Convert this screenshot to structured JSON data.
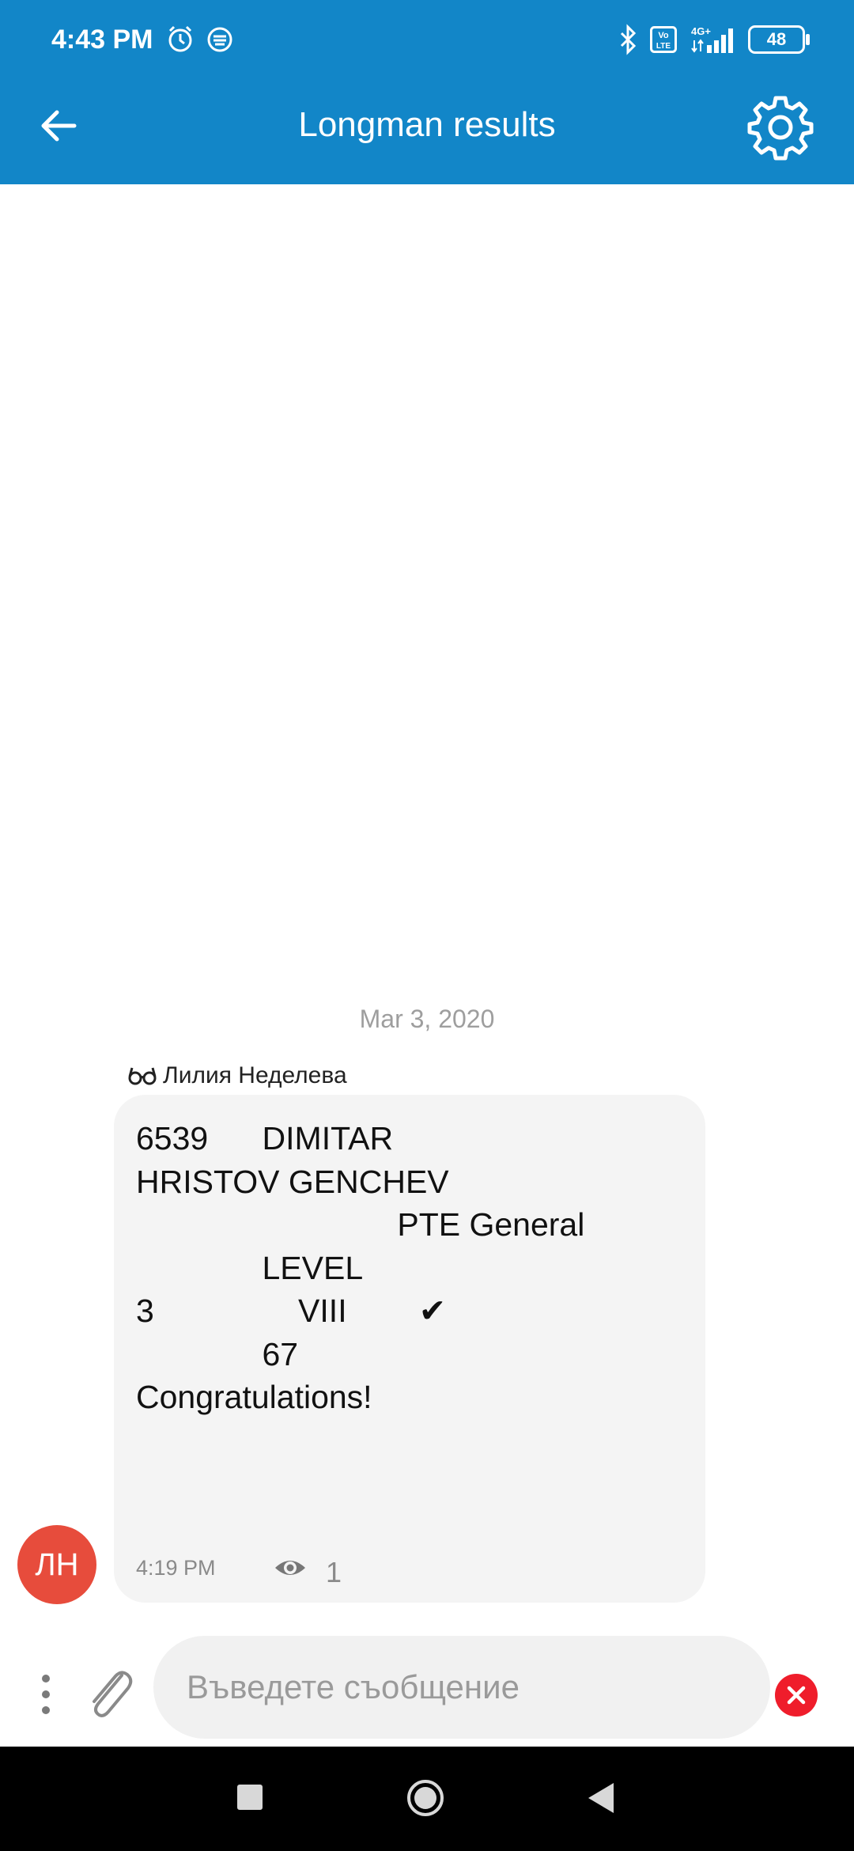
{
  "status_bar": {
    "time": "4:43 PM",
    "battery": "48",
    "network": "4G+",
    "icons": [
      "alarm-icon",
      "app-notification-icon",
      "bluetooth-icon",
      "volte-icon",
      "signal-icon",
      "battery-icon"
    ]
  },
  "header": {
    "title": "Longman results",
    "back_icon": "arrow-left-icon",
    "settings_icon": "gear-icon"
  },
  "chat": {
    "date_separator": "Mar 3, 2020",
    "messages": [
      {
        "sender": "Лилия Неделева",
        "sender_icon": "glasses-icon",
        "avatar_initials": "ЛН",
        "avatar_color": "#e74c3c",
        "text": "6539      DIMITAR\nHRISTOV GENCHEV\n                             PTE General\n              LEVEL\n3                VIII        ✔\n              67\nCongratulations!",
        "time": "4:19 PM",
        "seen_count": "1"
      }
    ]
  },
  "composer": {
    "placeholder": "Въведете съобщение",
    "value": ""
  },
  "colors": {
    "header": "#1286c8",
    "bubble": "#f4f4f4",
    "cancel": "#ef1d2b"
  }
}
